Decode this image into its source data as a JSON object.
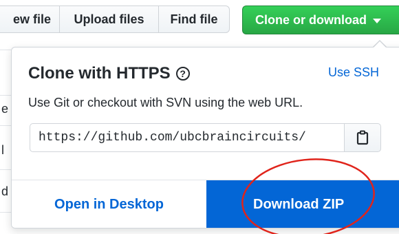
{
  "toolbar": {
    "new_file_label": "ew file",
    "upload_label": "Upload files",
    "find_label": "Find file",
    "clone_label": "Clone or download"
  },
  "background_list": {
    "chars": [
      "e",
      "l",
      "d"
    ]
  },
  "clone_panel": {
    "title": "Clone with HTTPS",
    "help_icon": "question-circle-icon",
    "help_glyph": "?",
    "use_ssh_label": "Use SSH",
    "description": "Use Git or checkout with SVN using the web URL.",
    "url_value": "https://github.com/ubcbraincircuits/",
    "copy_icon": "clipboard-icon"
  },
  "footer": {
    "open_desktop_label": "Open in Desktop",
    "download_zip_label": "Download ZIP"
  },
  "colors": {
    "primary_green": "#28a745",
    "link_blue": "#0366d6",
    "annotation_red": "#e0241b"
  }
}
